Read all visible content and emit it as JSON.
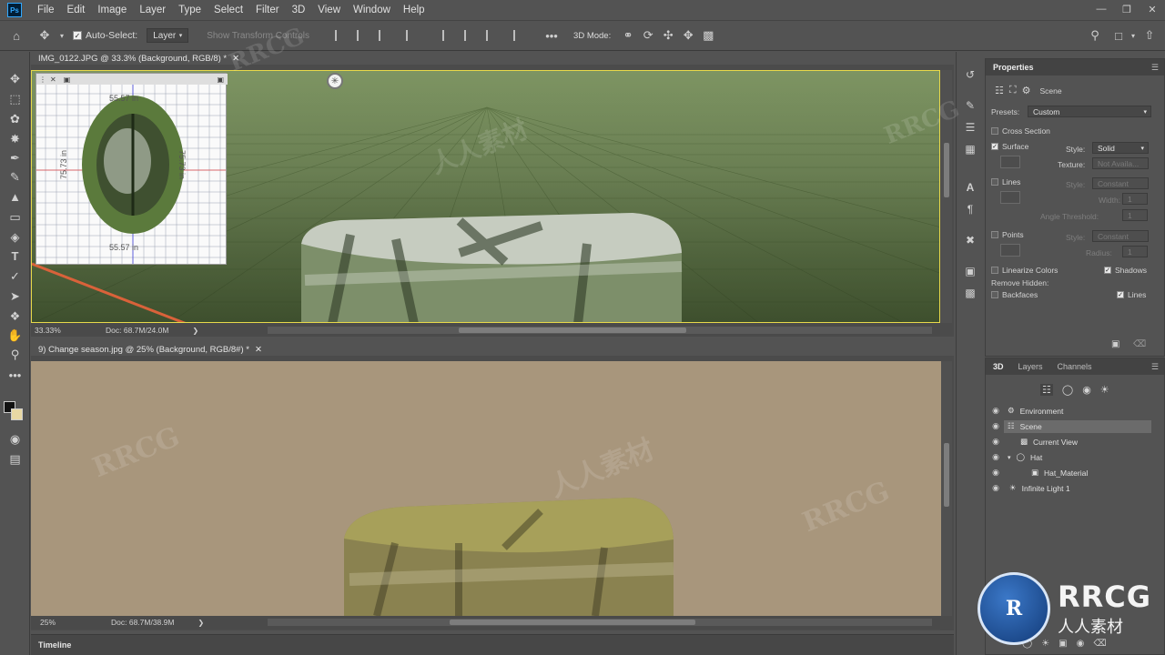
{
  "menu": [
    "File",
    "Edit",
    "Image",
    "Layer",
    "Type",
    "Select",
    "Filter",
    "3D",
    "View",
    "Window",
    "Help"
  ],
  "app_logo": "Ps",
  "options": {
    "auto_select_label": "Auto-Select:",
    "auto_select_value": "Layer",
    "show_transform_label": "Show Transform Controls",
    "mode_label": "3D Mode:"
  },
  "doc1": {
    "tab_title": "IMG_0122.JPG @ 33.3% (Background, RGB/8) *",
    "zoom": "33.33%",
    "doc_info": "Doc: 68.7M/24.0M",
    "uv_labels": {
      "top": "55.57 in",
      "bottom": "55.57 in",
      "left": "75.73 in",
      "right": "75.73 in"
    }
  },
  "doc2": {
    "tab_title": "9) Change season.jpg @ 25% (Background, RGB/8#) *",
    "zoom": "25%",
    "doc_info": "Doc: 68.7M/38.9M"
  },
  "timeline_label": "Timeline",
  "properties": {
    "tab": "Properties",
    "header": "Scene",
    "presets_label": "Presets:",
    "presets_value": "Custom",
    "cross_section": "Cross Section",
    "surface": "Surface",
    "surface_style_label": "Style:",
    "surface_style": "Solid",
    "texture_label": "Texture:",
    "texture_value": "Not Availa...",
    "lines": "Lines",
    "lines_style_label": "Style:",
    "lines_style": "Constant",
    "width_label": "Width:",
    "width_value": "1",
    "angle_label": "Angle Threshold:",
    "angle_value": "1",
    "points": "Points",
    "points_style_label": "Style:",
    "points_style": "Constant",
    "radius_label": "Radius:",
    "radius_value": "1",
    "linearize": "Linearize Colors",
    "shadows": "Shadows",
    "remove_hidden": "Remove Hidden:",
    "backfaces": "Backfaces",
    "lines_check": "Lines"
  },
  "layers_panel": {
    "tabs": [
      "3D",
      "Layers",
      "Channels"
    ],
    "items": [
      {
        "label": "Environment",
        "indent": 0
      },
      {
        "label": "Scene",
        "indent": 0,
        "selected": true
      },
      {
        "label": "Current View",
        "indent": 1
      },
      {
        "label": "Hat",
        "indent": 1
      },
      {
        "label": "Hat_Material",
        "indent": 2
      },
      {
        "label": "Infinite Light 1",
        "indent": 1
      }
    ]
  },
  "watermark": {
    "brand": "RRCG",
    "cn": "人人素材"
  },
  "colors": {
    "bg": "#535353",
    "canvas1": "#7d9462",
    "canvas2": "#a8967c",
    "accent": "#31a8ff",
    "selection": "#e8d94a"
  }
}
